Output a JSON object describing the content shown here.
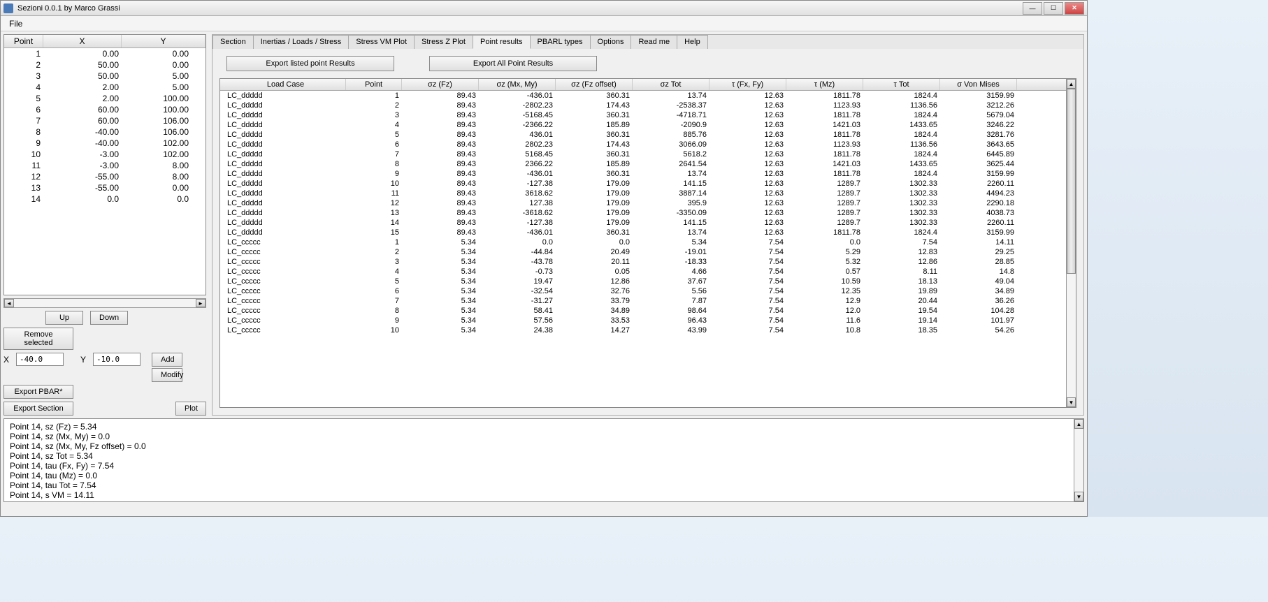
{
  "window": {
    "title": "Sezioni 0.0.1 by Marco Grassi"
  },
  "menu": {
    "file": "File"
  },
  "points_table": {
    "headers": {
      "point": "Point",
      "x": "X",
      "y": "Y"
    },
    "rows": [
      {
        "point": "1",
        "x": "0.00",
        "y": "0.00"
      },
      {
        "point": "2",
        "x": "50.00",
        "y": "0.00"
      },
      {
        "point": "3",
        "x": "50.00",
        "y": "5.00"
      },
      {
        "point": "4",
        "x": "2.00",
        "y": "5.00"
      },
      {
        "point": "5",
        "x": "2.00",
        "y": "100.00"
      },
      {
        "point": "6",
        "x": "60.00",
        "y": "100.00"
      },
      {
        "point": "7",
        "x": "60.00",
        "y": "106.00"
      },
      {
        "point": "8",
        "x": "-40.00",
        "y": "106.00"
      },
      {
        "point": "9",
        "x": "-40.00",
        "y": "102.00"
      },
      {
        "point": "10",
        "x": "-3.00",
        "y": "102.00"
      },
      {
        "point": "11",
        "x": "-3.00",
        "y": "8.00"
      },
      {
        "point": "12",
        "x": "-55.00",
        "y": "8.00"
      },
      {
        "point": "13",
        "x": "-55.00",
        "y": "0.00"
      },
      {
        "point": "14",
        "x": "0.0",
        "y": "0.0"
      }
    ]
  },
  "left_controls": {
    "up": "Up",
    "down": "Down",
    "remove": "Remove selected",
    "add": "Add",
    "modify": "Modify",
    "x_label": "X",
    "y_label": "Y",
    "x_value": "-40.0",
    "y_value": "-10.0",
    "export_pbar": "Export PBAR*",
    "export_section": "Export Section",
    "plot": "Plot"
  },
  "tabs": [
    "Section",
    "Inertias / Loads / Stress",
    "Stress VM Plot",
    "Stress Z Plot",
    "Point results",
    "PBARL types",
    "Options",
    "Read me",
    "Help"
  ],
  "active_tab": "Point results",
  "export_buttons": {
    "listed": "Export listed point Results",
    "all": "Export All Point Results"
  },
  "results_table": {
    "headers": [
      "Load Case",
      "Point",
      "σz (Fz)",
      "σz (Mx, My)",
      "σz (Fz offset)",
      "σz Tot",
      "τ (Fx, Fy)",
      "τ (Mz)",
      "τ Tot",
      "σ Von Mises"
    ],
    "rows": [
      [
        "LC_ddddd",
        "1",
        "89.43",
        "-436.01",
        "360.31",
        "13.74",
        "12.63",
        "1811.78",
        "1824.4",
        "3159.99"
      ],
      [
        "LC_ddddd",
        "2",
        "89.43",
        "-2802.23",
        "174.43",
        "-2538.37",
        "12.63",
        "1123.93",
        "1136.56",
        "3212.26"
      ],
      [
        "LC_ddddd",
        "3",
        "89.43",
        "-5168.45",
        "360.31",
        "-4718.71",
        "12.63",
        "1811.78",
        "1824.4",
        "5679.04"
      ],
      [
        "LC_ddddd",
        "4",
        "89.43",
        "-2366.22",
        "185.89",
        "-2090.9",
        "12.63",
        "1421.03",
        "1433.65",
        "3246.22"
      ],
      [
        "LC_ddddd",
        "5",
        "89.43",
        "436.01",
        "360.31",
        "885.76",
        "12.63",
        "1811.78",
        "1824.4",
        "3281.76"
      ],
      [
        "LC_ddddd",
        "6",
        "89.43",
        "2802.23",
        "174.43",
        "3066.09",
        "12.63",
        "1123.93",
        "1136.56",
        "3643.65"
      ],
      [
        "LC_ddddd",
        "7",
        "89.43",
        "5168.45",
        "360.31",
        "5618.2",
        "12.63",
        "1811.78",
        "1824.4",
        "6445.89"
      ],
      [
        "LC_ddddd",
        "8",
        "89.43",
        "2366.22",
        "185.89",
        "2641.54",
        "12.63",
        "1421.03",
        "1433.65",
        "3625.44"
      ],
      [
        "LC_ddddd",
        "9",
        "89.43",
        "-436.01",
        "360.31",
        "13.74",
        "12.63",
        "1811.78",
        "1824.4",
        "3159.99"
      ],
      [
        "LC_ddddd",
        "10",
        "89.43",
        "-127.38",
        "179.09",
        "141.15",
        "12.63",
        "1289.7",
        "1302.33",
        "2260.11"
      ],
      [
        "LC_ddddd",
        "11",
        "89.43",
        "3618.62",
        "179.09",
        "3887.14",
        "12.63",
        "1289.7",
        "1302.33",
        "4494.23"
      ],
      [
        "LC_ddddd",
        "12",
        "89.43",
        "127.38",
        "179.09",
        "395.9",
        "12.63",
        "1289.7",
        "1302.33",
        "2290.18"
      ],
      [
        "LC_ddddd",
        "13",
        "89.43",
        "-3618.62",
        "179.09",
        "-3350.09",
        "12.63",
        "1289.7",
        "1302.33",
        "4038.73"
      ],
      [
        "LC_ddddd",
        "14",
        "89.43",
        "-127.38",
        "179.09",
        "141.15",
        "12.63",
        "1289.7",
        "1302.33",
        "2260.11"
      ],
      [
        "LC_ddddd",
        "15",
        "89.43",
        "-436.01",
        "360.31",
        "13.74",
        "12.63",
        "1811.78",
        "1824.4",
        "3159.99"
      ],
      [
        "LC_ccccc",
        "1",
        "5.34",
        "0.0",
        "0.0",
        "5.34",
        "7.54",
        "0.0",
        "7.54",
        "14.11"
      ],
      [
        "LC_ccccc",
        "2",
        "5.34",
        "-44.84",
        "20.49",
        "-19.01",
        "7.54",
        "5.29",
        "12.83",
        "29.25"
      ],
      [
        "LC_ccccc",
        "3",
        "5.34",
        "-43.78",
        "20.11",
        "-18.33",
        "7.54",
        "5.32",
        "12.86",
        "28.85"
      ],
      [
        "LC_ccccc",
        "4",
        "5.34",
        "-0.73",
        "0.05",
        "4.66",
        "7.54",
        "0.57",
        "8.11",
        "14.8"
      ],
      [
        "LC_ccccc",
        "5",
        "5.34",
        "19.47",
        "12.86",
        "37.67",
        "7.54",
        "10.59",
        "18.13",
        "49.04"
      ],
      [
        "LC_ccccc",
        "6",
        "5.34",
        "-32.54",
        "32.76",
        "5.56",
        "7.54",
        "12.35",
        "19.89",
        "34.89"
      ],
      [
        "LC_ccccc",
        "7",
        "5.34",
        "-31.27",
        "33.79",
        "7.87",
        "7.54",
        "12.9",
        "20.44",
        "36.26"
      ],
      [
        "LC_ccccc",
        "8",
        "5.34",
        "58.41",
        "34.89",
        "98.64",
        "7.54",
        "12.0",
        "19.54",
        "104.28"
      ],
      [
        "LC_ccccc",
        "9",
        "5.34",
        "57.56",
        "33.53",
        "96.43",
        "7.54",
        "11.6",
        "19.14",
        "101.97"
      ],
      [
        "LC_ccccc",
        "10",
        "5.34",
        "24.38",
        "14.27",
        "43.99",
        "7.54",
        "10.8",
        "18.35",
        "54.26"
      ]
    ]
  },
  "console": {
    "lines": [
      "Point 14, sz (Fz) = 5.34",
      "Point 14, sz (Mx, My) = 0.0",
      "Point 14, sz (Mx, My, Fz offset) = 0.0",
      "Point 14, sz Tot = 5.34",
      "Point 14, tau (Fx, Fy) = 7.54",
      "Point 14, tau (Mz) = 0.0",
      "Point 14, tau Tot = 7.54",
      "Point 14, s VM = 14.11"
    ]
  }
}
